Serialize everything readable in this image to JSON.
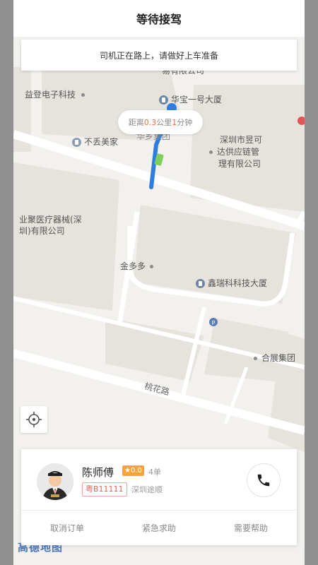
{
  "header": {
    "title": "等待接驾"
  },
  "status_banner": {
    "text": "司机正在路上，请做好上车准备"
  },
  "eta": {
    "prefix": "距离",
    "distance_value": "0.3",
    "distance_unit": "公里",
    "time_value": "1",
    "time_unit": "分钟"
  },
  "map": {
    "labels": {
      "company_top": "易有限公司",
      "yideng": "益登电子科技",
      "huabao": "华宝一号大厦",
      "huaxiang": "华乡集团",
      "budiu": "不丢美家",
      "shenzhen_line1": "深圳市昱可",
      "shenzhen_line2": "达供应链管",
      "shenzhen_line3": "理有限公司",
      "yeju_line1": "业聚医疗器械(深",
      "yeju_line2": "圳)有限公司",
      "jinduoduo": "金多多",
      "xinrui": "鑫瑞科科技大厦",
      "hezhan": "合展集团",
      "taohua_road": "桃花路"
    },
    "logo": "高德地图",
    "colors": {
      "route": "#2f7de1",
      "background": "#f3f1ee",
      "block": "#e6e3dd"
    }
  },
  "driver": {
    "name": "陈师傅",
    "rating": "★0.0",
    "orders": "4单",
    "plate": "粤B11111",
    "company": "深圳途顺"
  },
  "actions": {
    "cancel": "取消订单",
    "emergency": "紧急求助",
    "help": "需要帮助"
  }
}
